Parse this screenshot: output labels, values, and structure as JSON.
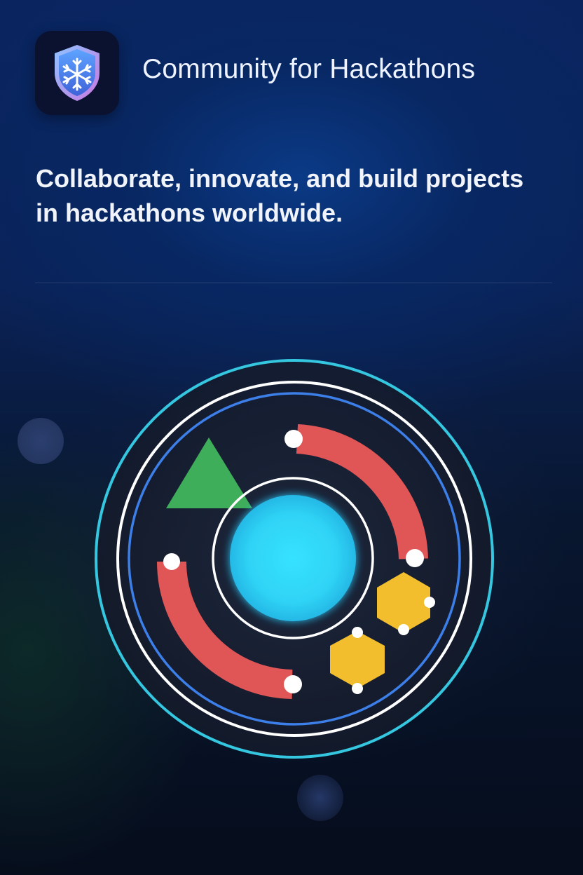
{
  "header": {
    "app_icon": "shield-snowflake-icon",
    "app_title": "Community for Hackathons"
  },
  "hero": {
    "tagline": "Collaborate, innovate, and build projects in hackathons worldwide."
  },
  "illustration": {
    "icon": "hackathon-orbit-illustration",
    "colors": {
      "outer_ring": "#35c6e0",
      "white_ring": "#ffffff",
      "blue_ring": "#3d7fe8",
      "core": "#2fd6f7",
      "arcs": "#e05555",
      "triangle": "#3fae5b",
      "hexagons": "#f2be2e",
      "nodes": "#ffffff"
    }
  }
}
